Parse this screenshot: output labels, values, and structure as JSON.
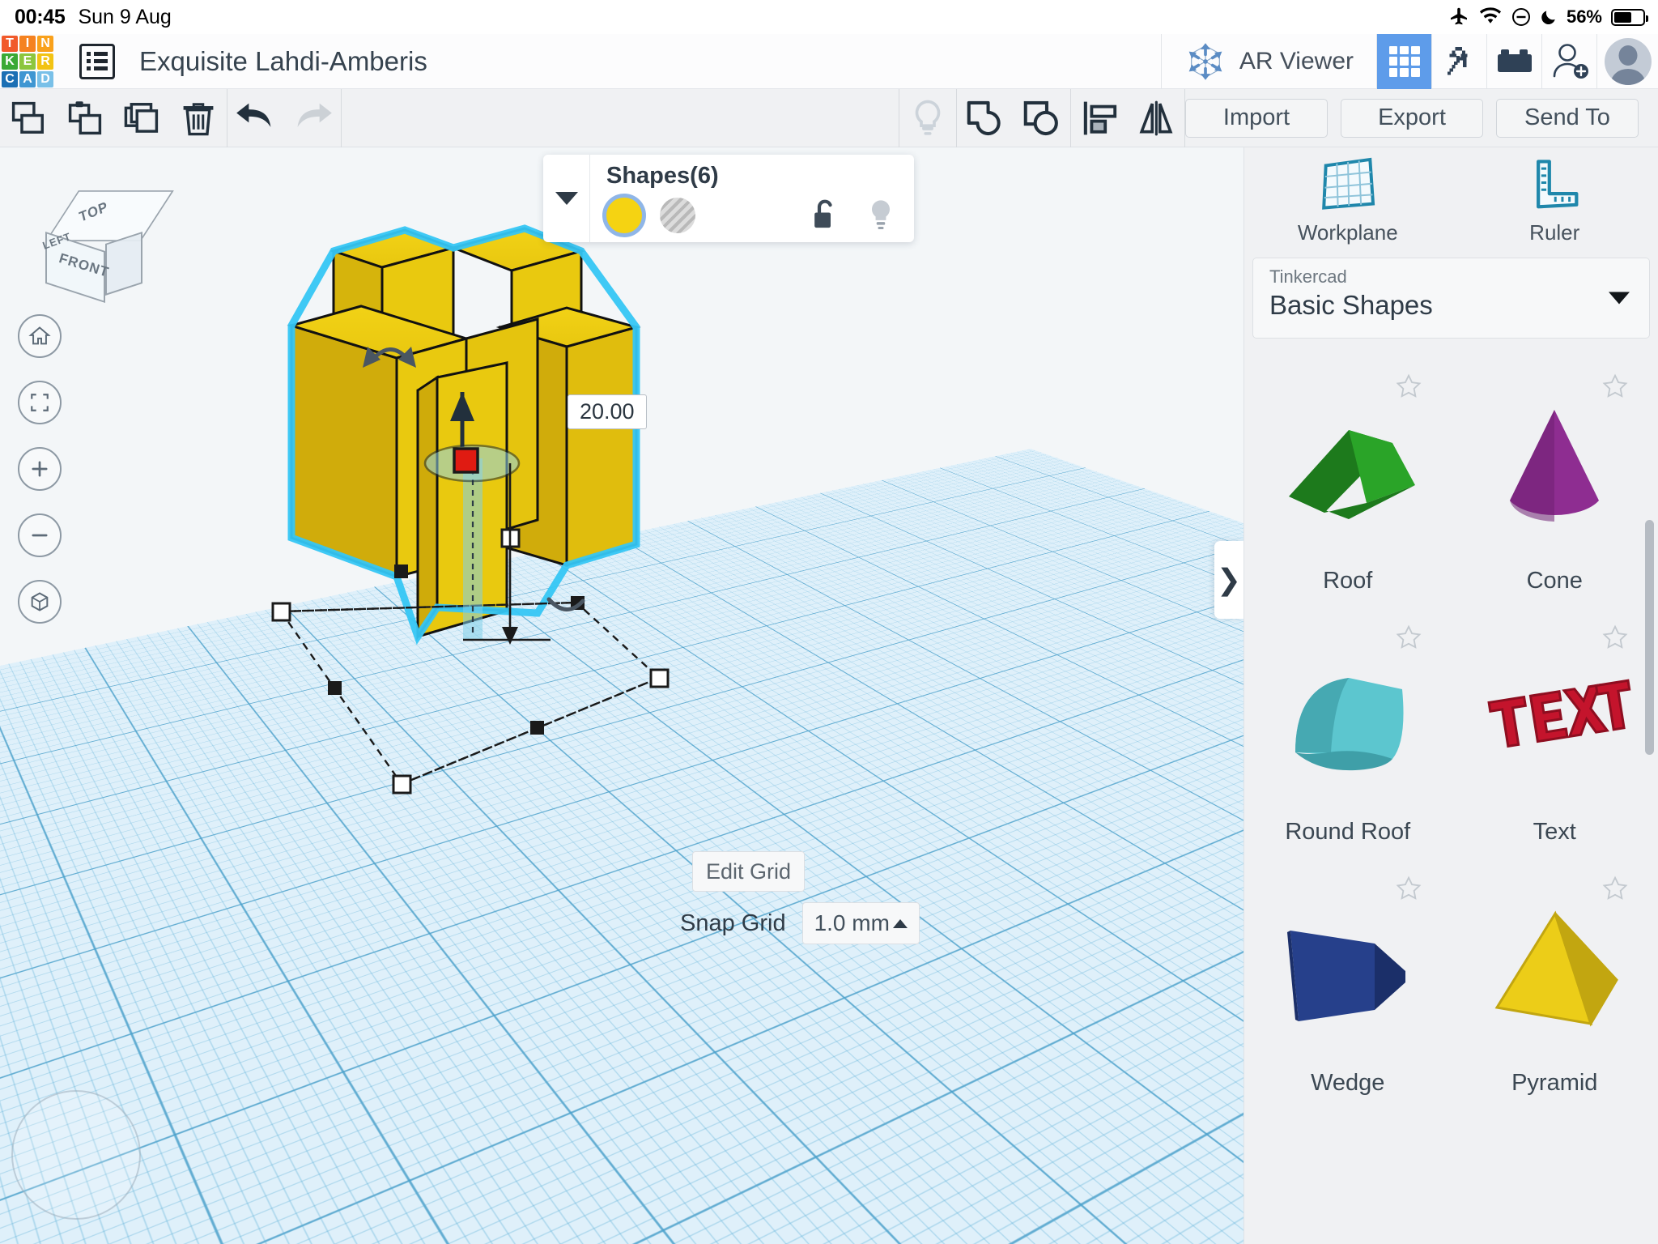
{
  "statusbar": {
    "time": "00:45",
    "date": "Sun 9 Aug",
    "battery_percent": "56%",
    "icons": [
      "airplane-mode-icon",
      "wifi-icon",
      "do-not-disturb-icon",
      "moon-icon",
      "battery-icon"
    ]
  },
  "header": {
    "logo_rows": [
      [
        {
          "l": "T",
          "c": "#f15a2b"
        },
        {
          "l": "I",
          "c": "#f58220"
        },
        {
          "l": "N",
          "c": "#f9a11b"
        }
      ],
      [
        {
          "l": "K",
          "c": "#3aa935"
        },
        {
          "l": "E",
          "c": "#8cc63e"
        },
        {
          "l": "R",
          "c": "#f2c314"
        }
      ],
      [
        {
          "l": "C",
          "c": "#1b6fb4"
        },
        {
          "l": "A",
          "c": "#3f96d2"
        },
        {
          "l": "D",
          "c": "#79c0e8"
        }
      ]
    ],
    "document_title": "Exquisite Lahdi-Amberis",
    "ar_viewer_label": "AR Viewer",
    "icons": [
      "hamburger-menu-icon",
      "ar-viewer-icon",
      "grid-view-icon",
      "minecraft-pickaxe-icon",
      "lego-brick-icon",
      "add-collaborator-icon",
      "user-avatar"
    ]
  },
  "toolbar": {
    "left_icons": [
      "copy-icon",
      "paste-icon",
      "duplicate-icon",
      "delete-icon",
      "undo-icon",
      "redo-icon"
    ],
    "mid_icons": [
      "lightbulb-icon",
      "group-icon",
      "ungroup-icon",
      "align-icon",
      "mirror-icon"
    ],
    "import_label": "Import",
    "export_label": "Export",
    "send_to_label": "Send To"
  },
  "canvas": {
    "viewcube": {
      "top": "TOP",
      "front": "FRONT",
      "left": "LEFT"
    },
    "nav_icons": [
      "home-view-icon",
      "fit-to-view-icon",
      "zoom-in-icon",
      "zoom-out-icon",
      "ortho-perspective-icon"
    ],
    "dimension_label": "20.00",
    "expander_icon": "❯",
    "edit_grid_label": "Edit Grid",
    "snap_grid_label": "Snap Grid",
    "snap_grid_value": "1.0 mm"
  },
  "shapes_panel": {
    "title": "Shapes(6)",
    "solid_color": "#f5d312",
    "hole_label": "hole-swatch",
    "lock_icon": "unlock-icon",
    "light_icon": "lightbulb-icon"
  },
  "sidebar": {
    "tools": [
      {
        "label": "Workplane",
        "icon": "workplane-icon"
      },
      {
        "label": "Ruler",
        "icon": "ruler-icon"
      }
    ],
    "dropdown": {
      "supertitle": "Tinkercad",
      "value": "Basic Shapes"
    },
    "gallery": [
      {
        "label": "Roof",
        "icon": "roof-shape",
        "color": "#2aa428",
        "color2": "#1d7a1c"
      },
      {
        "label": "Cone",
        "icon": "cone-shape",
        "color": "#8e2d91",
        "color2": "#6f2172"
      },
      {
        "label": "Round Roof",
        "icon": "round-roof-shape",
        "color": "#5cc6cf",
        "color2": "#3f9fa8"
      },
      {
        "label": "Text",
        "icon": "text-shape",
        "color": "#c4142c",
        "color2": "#8e0e20"
      },
      {
        "label": "Wedge",
        "icon": "wedge-shape",
        "color": "#26408b",
        "color2": "#1b2f69"
      },
      {
        "label": "Pyramid",
        "icon": "pyramid-shape",
        "color": "#eccd18",
        "color2": "#c2a610"
      }
    ]
  }
}
